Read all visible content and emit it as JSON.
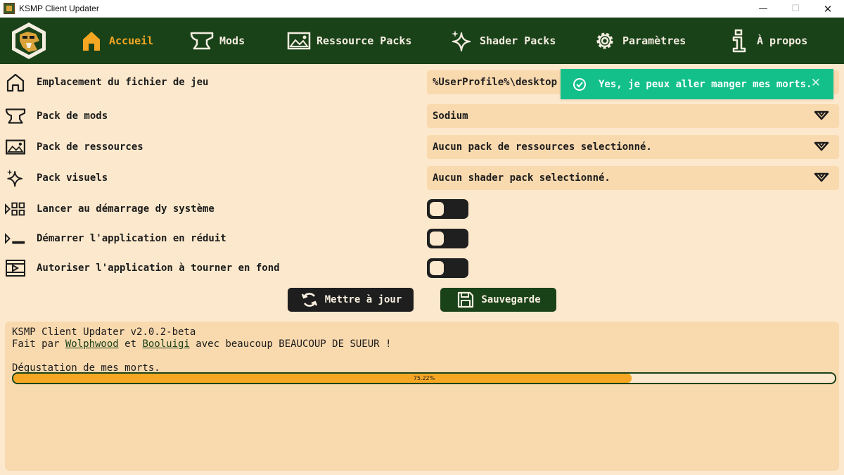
{
  "window": {
    "title": "KSMP Client Updater",
    "minimize": "—",
    "maximize": "☐",
    "close": "✕"
  },
  "nav": {
    "items": [
      {
        "label": "Accueil",
        "icon": "home-icon",
        "active": true
      },
      {
        "label": "Mods",
        "icon": "anvil-icon"
      },
      {
        "label": "Ressource Packs",
        "icon": "image-icon"
      },
      {
        "label": "Shader Packs",
        "icon": "sparkles-icon"
      },
      {
        "label": "Paramètres",
        "icon": "gear-icon"
      },
      {
        "label": "À propos",
        "icon": "info-icon"
      }
    ],
    "active_color": "#f5a623",
    "background": "#1a4219"
  },
  "form": {
    "game_location": {
      "label": "Emplacement du fichier de jeu",
      "value": "%UserProfile%\\desktop"
    },
    "mods_pack": {
      "label": "Pack de mods",
      "value": "Sodium"
    },
    "resource_pack": {
      "label": "Pack de ressources",
      "value": "Aucun pack de ressources selectionné."
    },
    "shader_pack": {
      "label": "Pack visuels",
      "value": "Aucun shader pack selectionné."
    },
    "startup": {
      "label": "Lancer au démarrage dy système",
      "checked": false
    },
    "start_minimized": {
      "label": "Démarrer l'application en réduit",
      "checked": false
    },
    "background_run": {
      "label": "Autoriser l'application à tourner en fond",
      "checked": false
    }
  },
  "buttons": {
    "update": "Mettre à jour",
    "save": "Sauvegarde"
  },
  "console": {
    "version": "KSMP Client Updater v2.0.2-beta",
    "credits_prefix": "Fait par ",
    "author1": "Wolphwood",
    "credits_mid": " et ",
    "author2": "Booluigi",
    "credits_suffix": " avec beaucoup BEAUCOUP DE SUEUR !",
    "status": "Dégustation de mes morts.",
    "progress_text": "75.22%",
    "progress": 0.7522
  },
  "toast": {
    "message": "Yes, je peux aller manger mes morts.",
    "close": "✕",
    "color": "#13c08a"
  }
}
